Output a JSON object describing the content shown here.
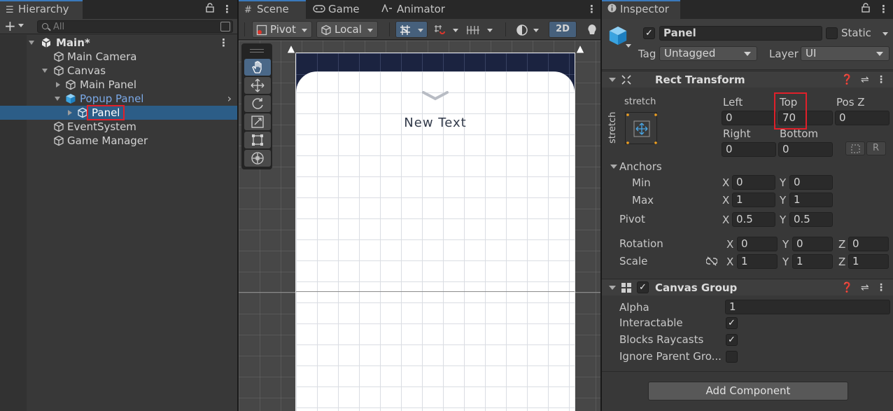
{
  "hierarchy": {
    "tab_label": "Hierarchy",
    "search_placeholder": "All",
    "items": [
      {
        "label": "Main*"
      },
      {
        "label": "Main Camera"
      },
      {
        "label": "Canvas"
      },
      {
        "label": "Main Panel"
      },
      {
        "label": "Popup Panel"
      },
      {
        "label": "Panel"
      },
      {
        "label": "EventSystem"
      },
      {
        "label": "Game Manager"
      }
    ]
  },
  "scene": {
    "tabs": [
      {
        "label": "Scene"
      },
      {
        "label": "Game"
      },
      {
        "label": "Animator"
      }
    ],
    "toolbar": {
      "pivot_label": "Pivot",
      "local_label": "Local",
      "mode_2d_label": "2D"
    },
    "canvas_text": "New Text"
  },
  "inspector": {
    "tab_label": "Inspector",
    "object_name": "Panel",
    "static_label": "Static",
    "tag_label": "Tag",
    "tag_value": "Untagged",
    "layer_label": "Layer",
    "layer_value": "UI",
    "rect_transform": {
      "title": "Rect Transform",
      "anchor_preset_h": "stretch",
      "anchor_preset_v": "stretch",
      "left_label": "Left",
      "left_value": "0",
      "top_label": "Top",
      "top_value": "70",
      "posz_label": "Pos Z",
      "posz_value": "0",
      "right_label": "Right",
      "right_value": "0",
      "bottom_label": "Bottom",
      "bottom_value": "0",
      "anchors_label": "Anchors",
      "min_label": "Min",
      "min_x": "0",
      "min_y": "0",
      "max_label": "Max",
      "max_x": "1",
      "max_y": "1",
      "pivot_label": "Pivot",
      "pivot_x": "0.5",
      "pivot_y": "0.5",
      "rotation_label": "Rotation",
      "rot_x": "0",
      "rot_y": "0",
      "rot_z": "0",
      "scale_label": "Scale",
      "scale_x": "1",
      "scale_y": "1",
      "scale_z": "1",
      "x_label": "X",
      "y_label": "Y",
      "z_label": "Z"
    },
    "canvas_group": {
      "title": "Canvas Group",
      "alpha_label": "Alpha",
      "alpha_value": "1",
      "interactable_label": "Interactable",
      "interactable_checked": true,
      "blocks_raycasts_label": "Blocks Raycasts",
      "blocks_raycasts_checked": true,
      "ignore_parent_label": "Ignore Parent Gro...",
      "ignore_parent_checked": false
    },
    "add_component_label": "Add Component"
  },
  "colors": {
    "selection": "#2c5d87",
    "highlight": "#e0202a",
    "prefab_text": "#7aa8e6",
    "panel_header": "#1b2340"
  }
}
